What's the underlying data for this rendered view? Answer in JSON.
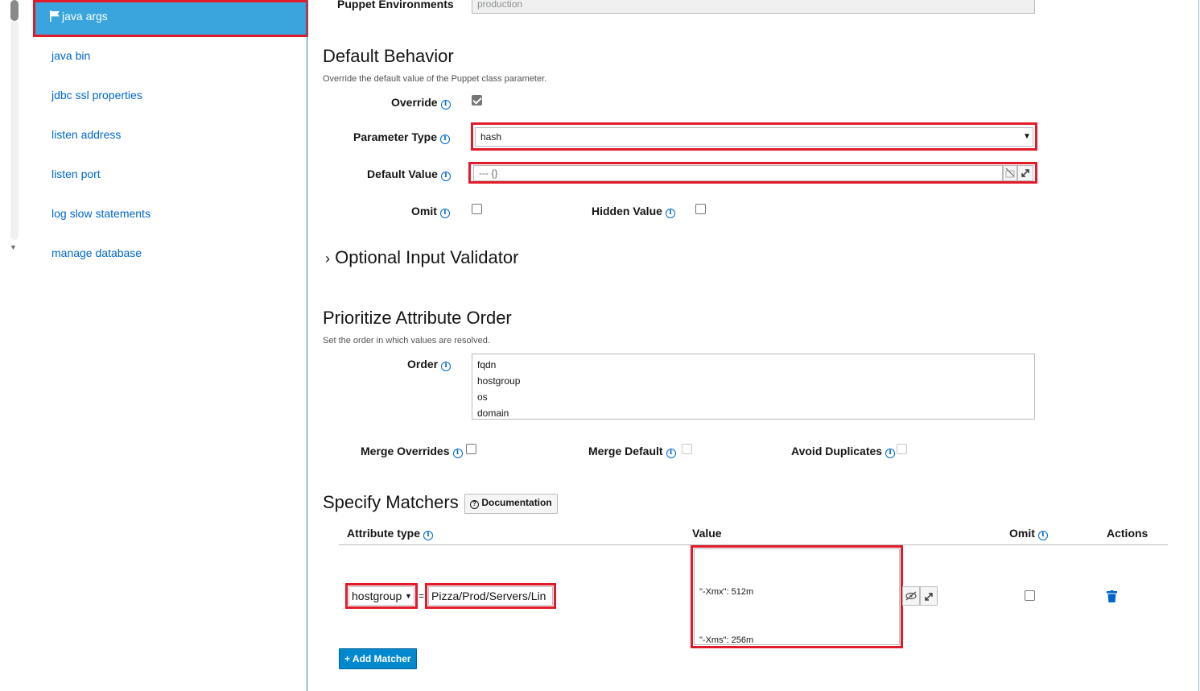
{
  "sidebar": {
    "active_item": "java args",
    "items": [
      "java bin",
      "jdbc ssl properties",
      "listen address",
      "listen port",
      "log slow statements",
      "manage database"
    ]
  },
  "environments": {
    "label": "Puppet Environments",
    "value": "production"
  },
  "default_behavior": {
    "heading": "Default Behavior",
    "help": "Override the default value of the Puppet class parameter.",
    "override_label": "Override",
    "override_checked": true,
    "parameter_type_label": "Parameter Type",
    "parameter_type_value": "hash",
    "default_value_label": "Default Value",
    "default_value": "--- {}",
    "omit_label": "Omit",
    "hidden_value_label": "Hidden Value"
  },
  "validator": {
    "heading": "Optional Input Validator"
  },
  "order_section": {
    "heading": "Prioritize Attribute Order",
    "help": "Set the order in which values are resolved.",
    "order_label": "Order",
    "order_lines": [
      "fqdn",
      "hostgroup",
      "os",
      "domain"
    ],
    "merge_overrides_label": "Merge Overrides",
    "merge_default_label": "Merge Default",
    "avoid_duplicates_label": "Avoid Duplicates"
  },
  "matchers": {
    "heading": "Specify Matchers",
    "doc_button": "Documentation",
    "columns": {
      "attribute_type": "Attribute type",
      "value": "Value",
      "omit": "Omit",
      "actions": "Actions"
    },
    "row": {
      "attribute": "hostgroup",
      "equals": "=",
      "match_value": "Pizza/Prod/Servers/Lin",
      "value_lines": [
        "\"-Xmx\": 512m",
        "\"-Xms\": 256m"
      ]
    },
    "add_button": "+ Add Matcher"
  },
  "colors": {
    "accent": "#39a5dc",
    "link": "#0066cc",
    "annotation": "#e21b2a",
    "primary_button": "#0088ce"
  }
}
